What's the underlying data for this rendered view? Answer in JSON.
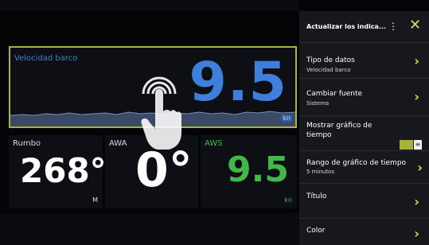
{
  "speed_gauge": {
    "label": "Velocidad barco",
    "value": "9.5",
    "unit": "kn"
  },
  "heading_gauge": {
    "label": "Rumbo",
    "value": "268°",
    "unit": "M"
  },
  "awa_gauge": {
    "label": "AWA",
    "value": "0°"
  },
  "aws_gauge": {
    "label": "AWS",
    "value": "9.5",
    "unit": "kn"
  },
  "menu": {
    "title": "Actualizar los indica...",
    "items": [
      {
        "label": "Tipo de datos",
        "sub": "Velocidad barco"
      },
      {
        "label": "Cambiar fuente",
        "sub": "Sistema"
      },
      {
        "label": "Mostrar gráfico de tiempo",
        "toggle": true
      },
      {
        "label": "Rango de gráfico de tiempo",
        "sub": "5 minutos"
      },
      {
        "label": "Título"
      },
      {
        "label": "Color"
      }
    ]
  },
  "colors": {
    "accent": "#d7e04c",
    "speed_blue": "#3e7fdc",
    "aws_green": "#43b84a"
  }
}
